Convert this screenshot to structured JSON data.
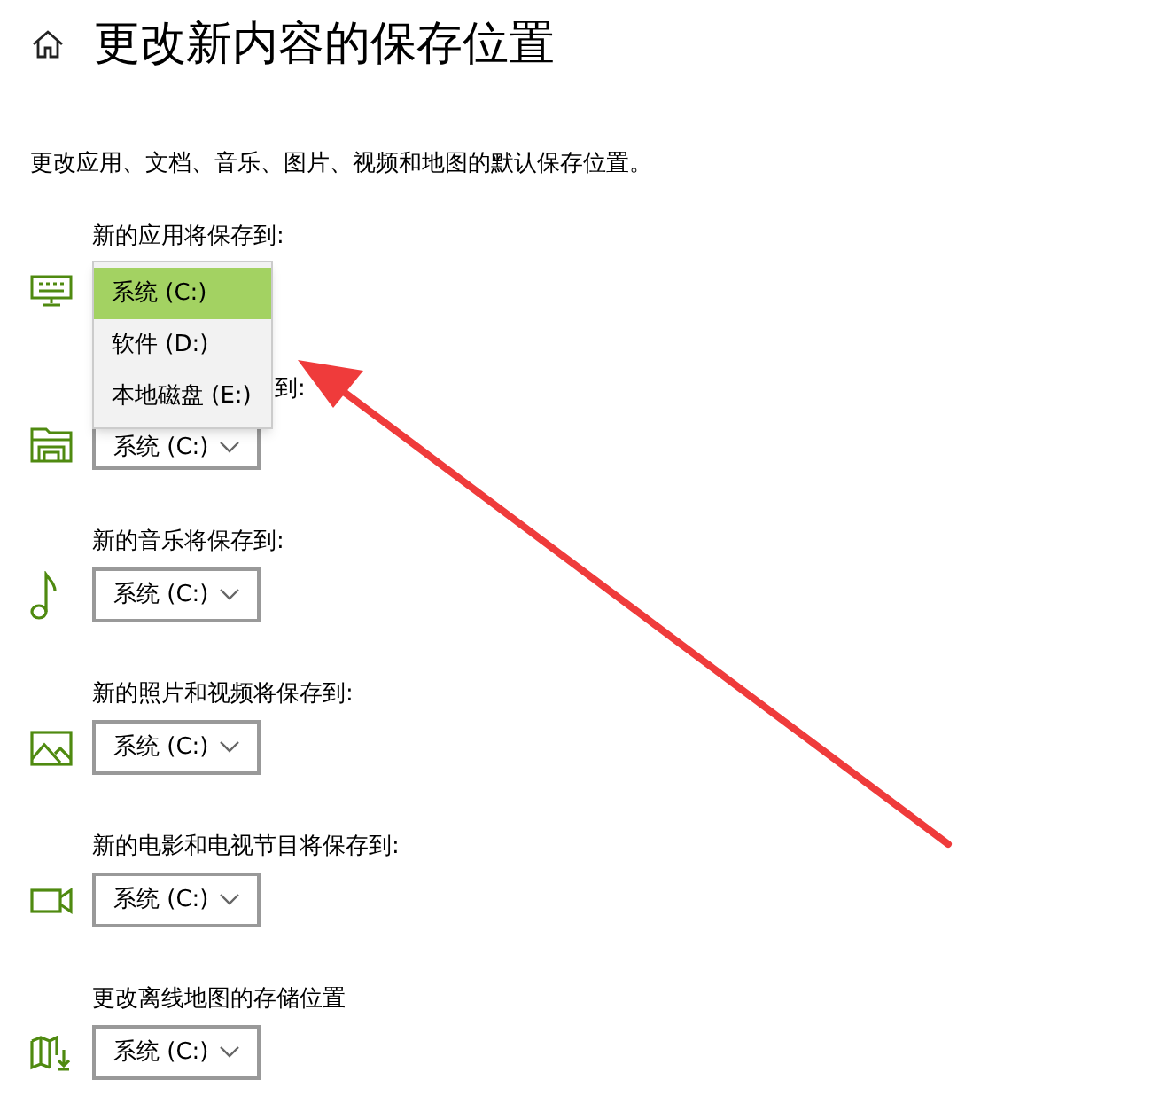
{
  "title": "更改新内容的保存位置",
  "description": "更改应用、文档、音乐、图片、视频和地图的默认保存位置。",
  "sections": [
    {
      "kind": "apps",
      "label": "新的应用将保存到:"
    },
    {
      "kind": "documents",
      "label": "到:",
      "value": "系统 (C:)"
    },
    {
      "kind": "music",
      "label": "新的音乐将保存到:",
      "value": "系统 (C:)"
    },
    {
      "kind": "photos",
      "label": "新的照片和视频将保存到:",
      "value": "系统 (C:)"
    },
    {
      "kind": "movies",
      "label": "新的电影和电视节目将保存到:",
      "value": "系统 (C:)"
    },
    {
      "kind": "maps",
      "label": "更改离线地图的存储位置",
      "value": "系统 (C:)"
    }
  ],
  "dropdown_menu": {
    "items": [
      {
        "label": "系统 (C:)",
        "selected": true
      },
      {
        "label": "软件 (D:)",
        "selected": false
      },
      {
        "label": "本地磁盘 (E:)",
        "selected": false
      }
    ]
  }
}
